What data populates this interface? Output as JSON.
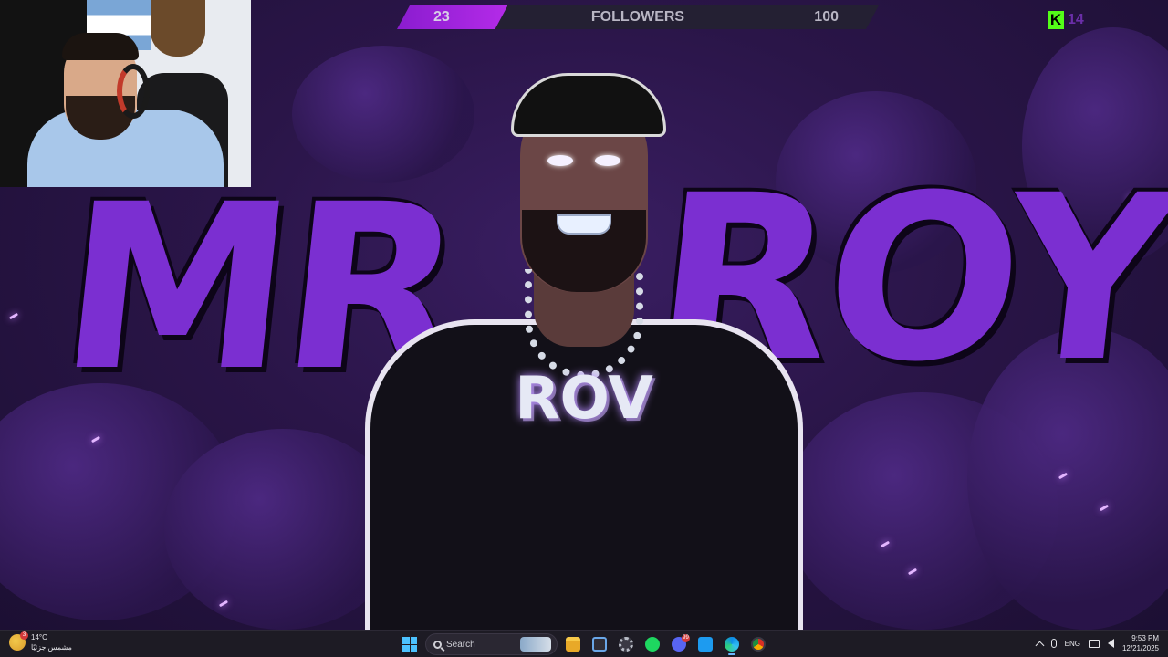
{
  "stream_overlay": {
    "follower_goal": {
      "current": "23",
      "label": "FOLLOWERS",
      "target": "100",
      "progress_fraction": 0.23
    },
    "kick_badge": {
      "logo_letter": "K",
      "count": "14",
      "brand_color": "#53fc18"
    }
  },
  "wallpaper": {
    "graffiti_left": "MR",
    "graffiti_right": "ROY",
    "shirt_text": "ROV",
    "accent_color": "#7b2fd1"
  },
  "taskbar": {
    "weather": {
      "temperature": "14°C",
      "condition": "مشمس جزئيًا",
      "badge": "3"
    },
    "search_placeholder": "Search",
    "apps": [
      {
        "name": "file-explorer"
      },
      {
        "name": "microsoft-store"
      },
      {
        "name": "settings"
      },
      {
        "name": "spotify"
      },
      {
        "name": "discord",
        "badge": "99"
      },
      {
        "name": "twitter"
      },
      {
        "name": "edge"
      },
      {
        "name": "chrome"
      }
    ],
    "tray": {
      "language": "ENG",
      "time": "9:53 PM",
      "date": "12/21/2025"
    }
  }
}
